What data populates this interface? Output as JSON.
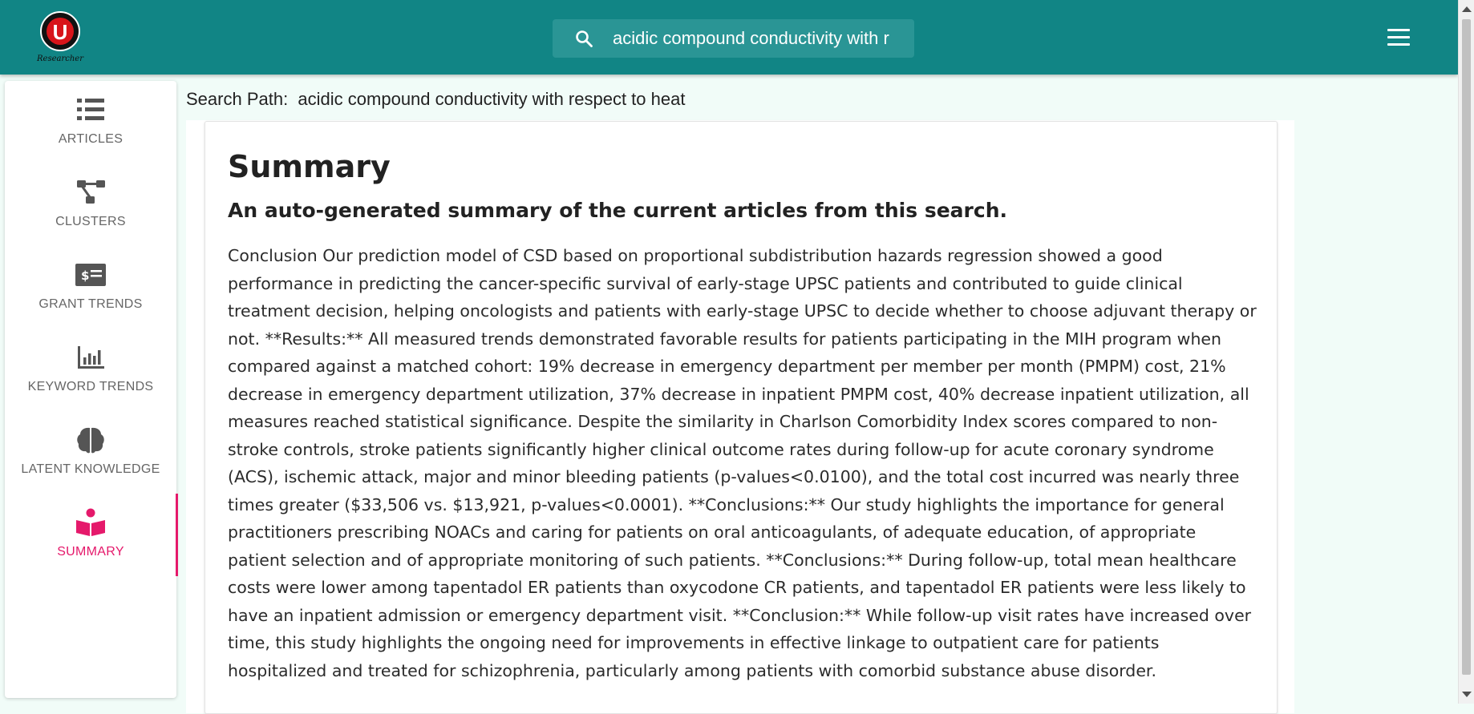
{
  "app": {
    "logo_letter": "U",
    "logo_caption": "Researcher"
  },
  "search": {
    "value": "acidic compound conductivity with r",
    "placeholder": "Search"
  },
  "sidebar": {
    "items": [
      {
        "label": "ARTICLES",
        "icon": "list-icon",
        "active": false
      },
      {
        "label": "CLUSTERS",
        "icon": "cluster-icon",
        "active": false
      },
      {
        "label": "GRANT TRENDS",
        "icon": "money-icon",
        "active": false
      },
      {
        "label": "KEYWORD TRENDS",
        "icon": "bar-chart-icon",
        "active": false
      },
      {
        "label": "LATENT KNOWLEDGE",
        "icon": "brain-icon",
        "active": false
      },
      {
        "label": "SUMMARY",
        "icon": "book-reader-icon",
        "active": true
      }
    ]
  },
  "search_path": {
    "label": "Search Path:",
    "value": "acidic compound conductivity with respect to heat"
  },
  "summary": {
    "title": "Summary",
    "subtitle": "An auto-generated summary of the current articles from this search.",
    "body": "Conclusion Our prediction model of CSD based on proportional subdistribution hazards regression showed a good performance in predicting the cancer-specific survival of early-stage UPSC patients and contributed to guide clinical treatment decision, helping oncologists and patients with early-stage UPSC to decide whether to choose adjuvant therapy or not. **Results:** All measured trends demonstrated favorable results for patients participating in the MIH program when compared against a matched cohort: 19% decrease in emergency department per member per month (PMPM) cost, 21% decrease in emergency department utilization, 37% decrease in inpatient PMPM cost, 40% decrease inpatient utilization, all measures reached statistical significance. Despite the similarity in Charlson Comorbidity Index scores compared to non-stroke controls, stroke patients significantly higher clinical outcome rates during follow-up for acute coronary syndrome (ACS), ischemic attack, major and minor bleeding patients (p-values<0.0100), and the total cost incurred was nearly three times greater ($33,506 vs. $13,921, p-values<0.0001). **Conclusions:** Our study highlights the importance for general practitioners prescribing NOACs and caring for patients on oral anticoagulants, of adequate education, of appropriate patient selection and of appropriate monitoring of such patients. **Conclusions:** During follow-up, total mean healthcare costs were lower among tapentadol ER patients than oxycodone CR patients, and tapentadol ER patients were less likely to have an inpatient admission or emergency department visit. **Conclusion:** While follow-up visit rates have increased over time, this study highlights the ongoing need for improvements in effective linkage to outpatient care for patients hospitalized and treated for schizophrenia, particularly among patients with comorbid substance abuse disorder."
  },
  "colors": {
    "header": "#118585",
    "accent": "#e5196b",
    "background": "#f1fcf8"
  }
}
